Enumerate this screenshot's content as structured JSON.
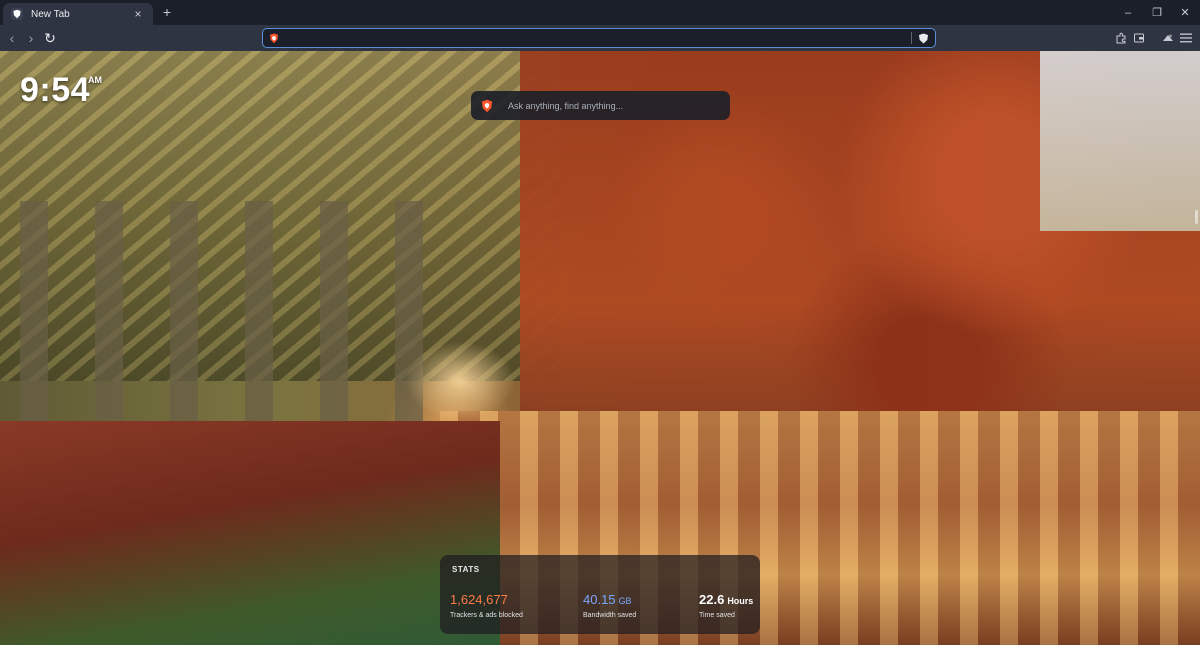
{
  "tab": {
    "title": "New Tab",
    "close": "×"
  },
  "tabstrip": {
    "new_tab": "+"
  },
  "window": {
    "minimize": "–",
    "restore": "❐",
    "close": "✕"
  },
  "toolbar": {
    "back": "‹",
    "forward": "›",
    "reload": "↻"
  },
  "address_bar": {
    "value": "",
    "placeholder": ""
  },
  "clock": {
    "time": "9:54",
    "ampm": "AM"
  },
  "search": {
    "placeholder": "Ask anything, find anything..."
  },
  "stats": {
    "title": "STATS",
    "trackers": {
      "value": "1,624,677",
      "label": "Trackers & ads blocked"
    },
    "bandwidth": {
      "value": "40.15",
      "unit": "GB",
      "label": "Bandwidth saved"
    },
    "time": {
      "value": "22.6",
      "unit": "Hours",
      "label": "Time saved"
    }
  },
  "colors": {
    "accent": "#5b8fd9",
    "trackers": "#ff7a45",
    "bandwidth": "#7aa7ff",
    "brave": "#fb542b"
  }
}
